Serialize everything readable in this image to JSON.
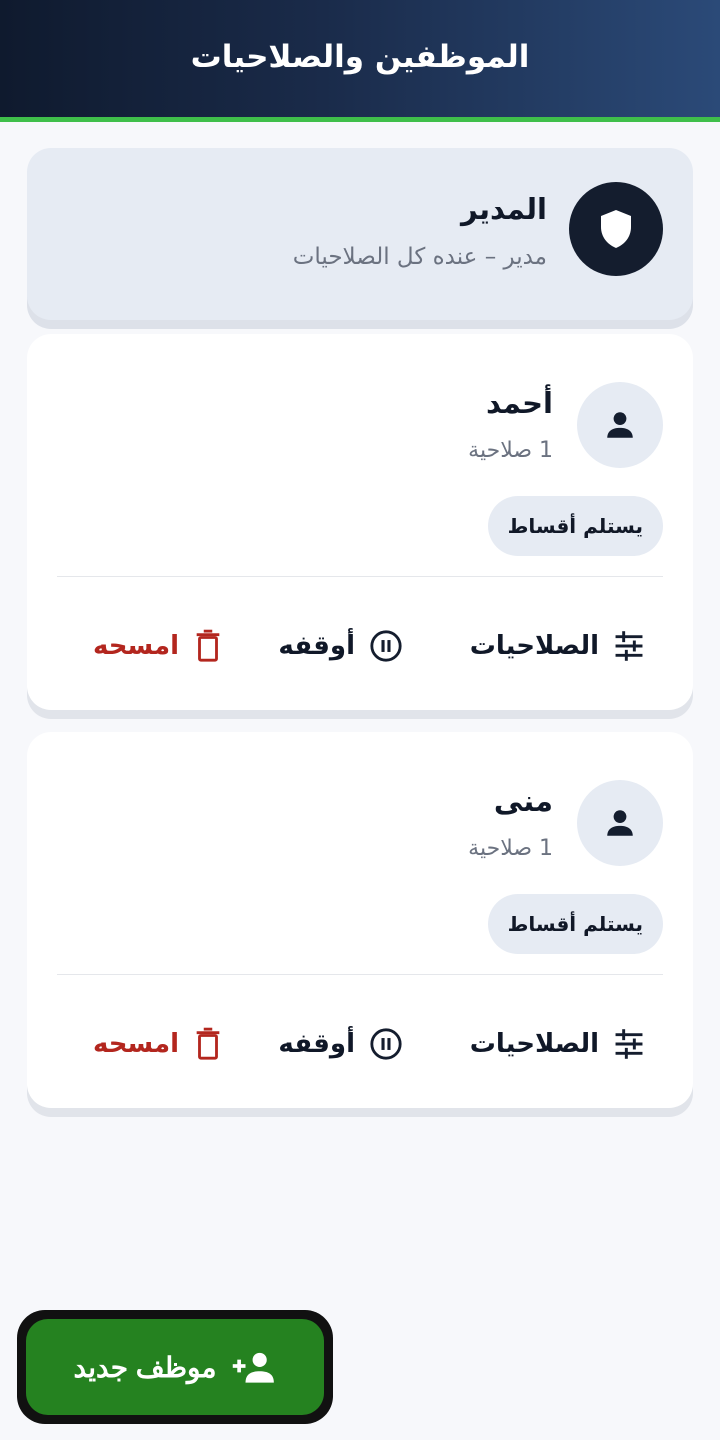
{
  "header": {
    "title": "الموظفين والصلاحيات"
  },
  "admin": {
    "name": "المدير",
    "subtitle": "مدير – عنده كل الصلاحيات",
    "icon": "shield-icon"
  },
  "employees": [
    {
      "name": "أحمد",
      "permission_count": "1 صلاحية",
      "permissions": [
        "يستلم أقساط"
      ],
      "actions": {
        "permissions": "الصلاحيات",
        "pause": "أوقفه",
        "delete": "امسحه"
      }
    },
    {
      "name": "منى",
      "permission_count": "1 صلاحية",
      "permissions": [
        "يستلم أقساط"
      ],
      "actions": {
        "permissions": "الصلاحيات",
        "pause": "أوقفه",
        "delete": "امسحه"
      }
    }
  ],
  "fab": {
    "label": "موظف جديد",
    "icon": "add-person-icon"
  },
  "colors": {
    "header_dark": "#0f1a2e",
    "header_accent_line": "#3fbf4a",
    "fab_green": "#258220",
    "delete_red": "#b3261e",
    "navy": "#141d2e"
  }
}
